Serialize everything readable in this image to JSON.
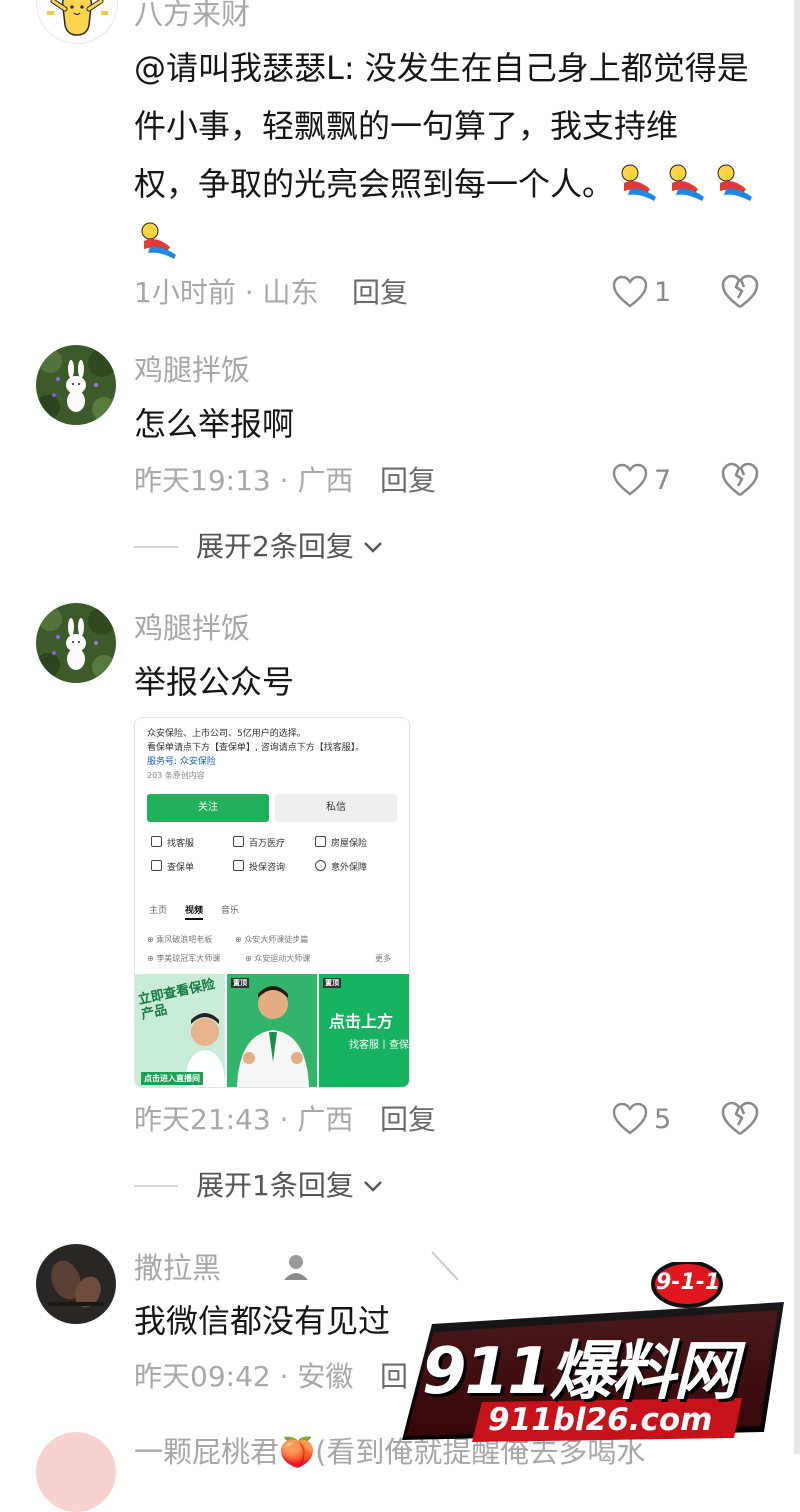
{
  "comments": [
    {
      "username": "八方来财",
      "text_lines": [
        "@请叫我瑟瑟L: 没发生在自己身上都觉得是",
        "件小事，轻飘飘的一句算了，我支持维",
        "权，争取的光亮会照到每一个人。"
      ],
      "emoji": "slide-emoji",
      "time_location": "1小时前 · 山东",
      "reply_label": "回复",
      "likes": "1"
    },
    {
      "username": "鸡腿拌饭",
      "text": "怎么举报啊",
      "time_location": "昨天19:13 · 广西",
      "reply_label": "回复",
      "likes": "7",
      "expand_label": "展开2条回复"
    },
    {
      "username": "鸡腿拌饭",
      "text": "举报公众号",
      "time_location": "昨天21:43 · 广西",
      "reply_label": "回复",
      "likes": "5",
      "expand_label": "展开1条回复",
      "image": {
        "line1": "众安保险、上市公司、5亿用户的选择。",
        "line2": "看保单请点下方【查保单】, 咨询请点下方【找客服】。",
        "line3": "服务号: 众安保险",
        "line4": "203 条原创内容",
        "follow": "关注",
        "message": "私信",
        "services": [
          "找客服",
          "百万医疗",
          "房屋保险",
          "查保单",
          "投保咨询",
          "意外保障"
        ],
        "tabs": [
          "主页",
          "视频",
          "音乐"
        ],
        "links": [
          "乘风破浪吧老板",
          "众安大师课徒步篇",
          "李美琼冠军大师课",
          "众安运动大师课"
        ],
        "more": "更多",
        "banner1": "立即查看保险产品",
        "banner1_tag": "点击进入直播间",
        "banner_top": "置顶",
        "banner3": "点击上方",
        "banner3_sub": "找客服丨查保"
      }
    },
    {
      "username": "撒拉黑",
      "text": "我微信都没有见过",
      "time_location": "昨天09:42 · 安徽",
      "reply_label": "回"
    },
    {
      "username": "一颗屁桃君🍑(看到俺就提醒俺去多喝水"
    }
  ],
  "watermark": {
    "badge": "9-1-1",
    "title": "911爆料网",
    "url": "911bl26.com"
  },
  "colors": {
    "green": "#23b05a",
    "watermark_red": "#d7161e"
  }
}
